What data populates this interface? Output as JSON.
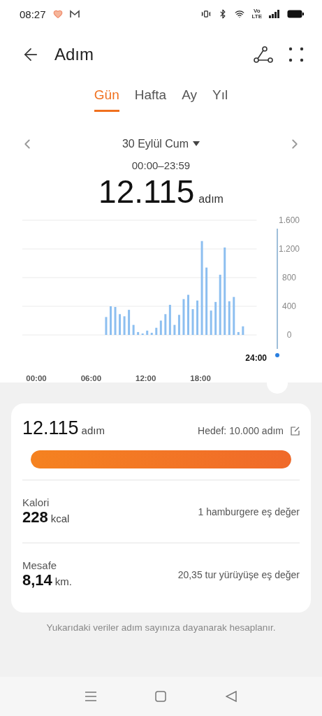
{
  "status_bar": {
    "time": "08:27",
    "network_label": [
      "Vo",
      "LTE"
    ]
  },
  "header": {
    "title": "Adım"
  },
  "tabs": [
    {
      "label": "Gün",
      "selected": true
    },
    {
      "label": "Hafta",
      "selected": false
    },
    {
      "label": "Ay",
      "selected": false
    },
    {
      "label": "Yıl",
      "selected": false
    }
  ],
  "date_nav": {
    "date": "30 Eylül Cum",
    "range": "00:00–23:59",
    "total": "12.115",
    "unit": "adım"
  },
  "chart": {
    "chart_data": {
      "type": "bar",
      "x": [
        7.5,
        8,
        8.5,
        9,
        9.5,
        10,
        10.5,
        11,
        11.5,
        12,
        12.5,
        13,
        13.5,
        14,
        14.5,
        15,
        15.5,
        16,
        16.5,
        17,
        17.5,
        18,
        18.5,
        19,
        19.5,
        20,
        20.5,
        21,
        21.5,
        22,
        22.5
      ],
      "series": [
        {
          "color": "#8dbff0",
          "values": [
            250,
            400,
            390,
            290,
            260,
            350,
            140,
            40,
            20,
            60,
            30,
            100,
            200,
            290,
            420,
            140,
            280,
            500,
            560,
            360,
            480,
            1310,
            940,
            340,
            460,
            840,
            1220,
            470,
            530,
            40,
            120
          ]
        }
      ],
      "xlim": [
        0,
        24
      ],
      "ylim": [
        0,
        1600
      ],
      "grid": true,
      "yticks": [
        {
          "value": 0,
          "label": "0"
        },
        {
          "value": 400,
          "label": "400"
        },
        {
          "value": 800,
          "label": "800"
        },
        {
          "value": 1200,
          "label": "1.200"
        },
        {
          "value": 1600,
          "label": "1.600"
        }
      ],
      "xticks": [
        {
          "value": 0,
          "label": "00:00"
        },
        {
          "value": 6,
          "label": "06:00"
        },
        {
          "value": 12,
          "label": "12:00"
        },
        {
          "value": 18,
          "label": "18:00"
        }
      ]
    },
    "cursor_label": "24:00"
  },
  "summary": {
    "steps": "12.115",
    "steps_unit": "adım",
    "goal": "Hedef: 10.000 adım",
    "level": 1,
    "rows": [
      {
        "label": "Kalori",
        "value": "228",
        "unit": "kcal",
        "note": "1 hamburgere eş değer"
      },
      {
        "label": "Mesafe",
        "value": "8,14",
        "unit": "km.",
        "note": "20,35 tur yürüyüşe eş değer"
      }
    ]
  },
  "footnote": "Yukarıdaki veriler adım sayınıza dayanarak hesaplanır."
}
